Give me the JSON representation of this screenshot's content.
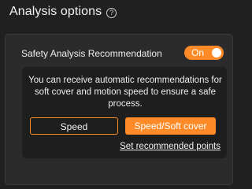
{
  "header": {
    "title": "Analysis options",
    "help_glyph": "?",
    "help_icon": "help-circle-icon"
  },
  "recommendation": {
    "label": "Safety Analysis Recommendation",
    "toggle_label": "On",
    "toggle_state": true,
    "description": "You can receive automatic recommendations for soft cover and motion speed to ensure a safe process.",
    "buttons": {
      "speed": "Speed",
      "speed_soft_cover": "Speed/Soft cover"
    },
    "link": "Set recommended points"
  },
  "colors": {
    "accent": "#ff8a28",
    "background": "#202020",
    "panel": "#2b2b2b",
    "inner_panel": "#1e1e1e"
  }
}
